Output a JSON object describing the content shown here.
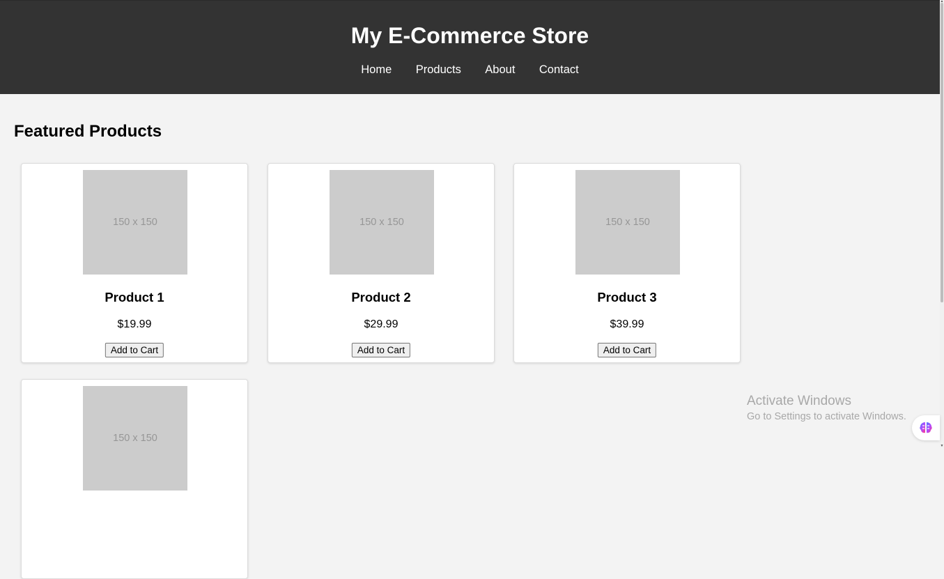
{
  "header": {
    "title": "My E-Commerce Store",
    "nav": [
      "Home",
      "Products",
      "About",
      "Contact"
    ]
  },
  "main": {
    "section_title": "Featured Products",
    "products": [
      {
        "image_text": "150 x 150",
        "name": "Product 1",
        "price": "$19.99",
        "button": "Add to Cart"
      },
      {
        "image_text": "150 x 150",
        "name": "Product 2",
        "price": "$29.99",
        "button": "Add to Cart"
      },
      {
        "image_text": "150 x 150",
        "name": "Product 3",
        "price": "$39.99",
        "button": "Add to Cart"
      },
      {
        "image_text": "150 x 150"
      }
    ]
  },
  "watermark": {
    "title": "Activate Windows",
    "subtitle": "Go to Settings to activate Windows."
  },
  "colors": {
    "header_bg": "#333333",
    "page_bg": "#f3f3f3",
    "placeholder_bg": "#cccccc"
  },
  "icons": {
    "assistant": "brain-icon"
  }
}
